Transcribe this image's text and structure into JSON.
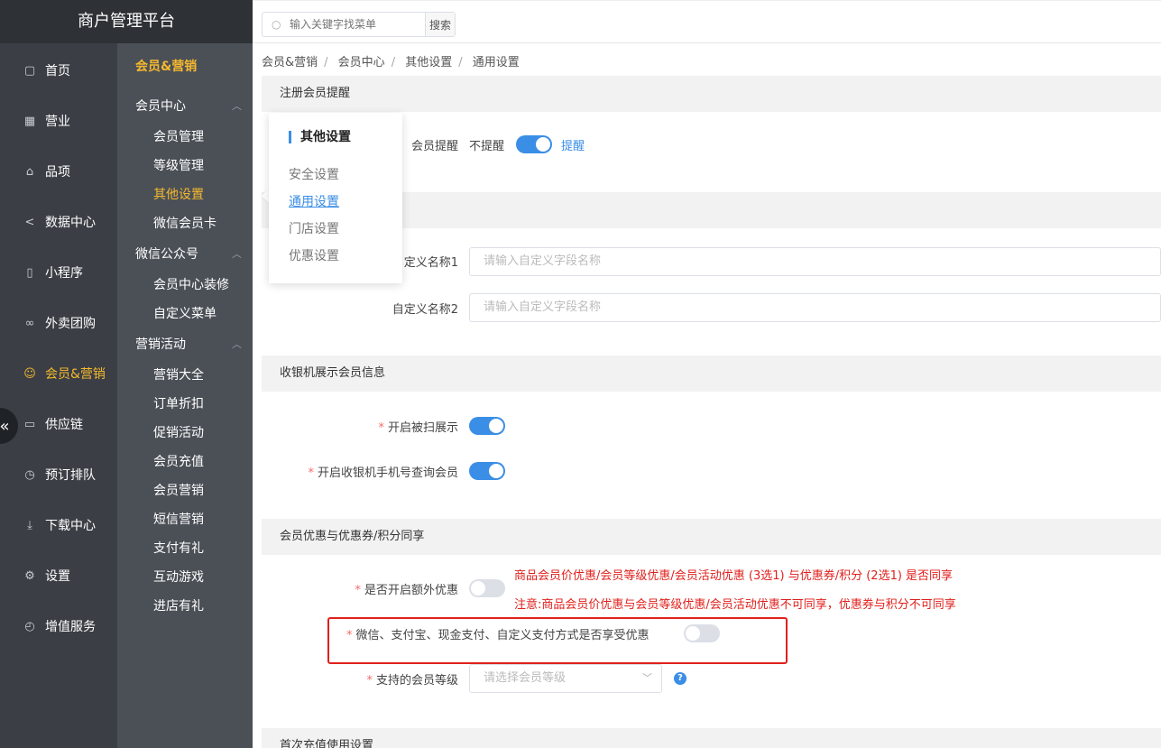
{
  "brand": "商户管理平台",
  "nav1": [
    {
      "label": "首页",
      "icon": "home-icon",
      "glyph": "▢",
      "active": false
    },
    {
      "label": "营业",
      "icon": "calendar-icon",
      "glyph": "▦",
      "active": false
    },
    {
      "label": "品项",
      "icon": "bag-icon",
      "glyph": "⌂",
      "active": false
    },
    {
      "label": "数据中心",
      "icon": "share-icon",
      "glyph": "<",
      "active": false
    },
    {
      "label": "小程序",
      "icon": "phone-icon",
      "glyph": "▯",
      "active": false
    },
    {
      "label": "外卖团购",
      "icon": "bike-icon",
      "glyph": "∞",
      "active": false
    },
    {
      "label": "会员&营销",
      "icon": "user-icon",
      "glyph": "☺",
      "active": true
    },
    {
      "label": "供应链",
      "icon": "truck-icon",
      "glyph": "▭",
      "active": false
    },
    {
      "label": "预订排队",
      "icon": "clock-icon",
      "glyph": "◷",
      "active": false
    },
    {
      "label": "下载中心",
      "icon": "download-icon",
      "glyph": "⤓",
      "active": false
    },
    {
      "label": "设置",
      "icon": "gear-icon",
      "glyph": "⚙",
      "active": false
    },
    {
      "label": "增值服务",
      "icon": "alarm-icon",
      "glyph": "◴",
      "active": false
    }
  ],
  "collapse_glyph": "«",
  "nav2": {
    "title": "会员&营销",
    "groups": [
      {
        "label": "会员中心",
        "items": [
          {
            "label": "会员管理",
            "active": false
          },
          {
            "label": "等级管理",
            "active": false
          },
          {
            "label": "其他设置",
            "active": true
          },
          {
            "label": "微信会员卡",
            "active": false
          }
        ]
      },
      {
        "label": "微信公众号",
        "items": [
          {
            "label": "会员中心装修",
            "active": false
          },
          {
            "label": "自定义菜单",
            "active": false
          }
        ]
      },
      {
        "label": "营销活动",
        "items": [
          {
            "label": "营销大全",
            "active": false
          },
          {
            "label": "订单折扣",
            "active": false
          },
          {
            "label": "促销活动",
            "active": false
          },
          {
            "label": "会员充值",
            "active": false
          },
          {
            "label": "会员营销",
            "active": false
          },
          {
            "label": "短信营销",
            "active": false
          },
          {
            "label": "支付有礼",
            "active": false
          },
          {
            "label": "互动游戏",
            "active": false
          },
          {
            "label": "进店有礼",
            "active": false
          }
        ]
      }
    ]
  },
  "search": {
    "placeholder": "输入关键字找菜单",
    "button": "搜索"
  },
  "breadcrumb": [
    "会员&营销",
    "会员中心",
    "其他设置",
    "通用设置"
  ],
  "popup": {
    "title": "其他设置",
    "items": [
      {
        "label": "安全设置",
        "active": false
      },
      {
        "label": "通用设置",
        "active": true
      },
      {
        "label": "门店设置",
        "active": false
      },
      {
        "label": "优惠设置",
        "active": false
      }
    ]
  },
  "sections": {
    "register": {
      "title": "注册会员提醒",
      "label": "会员提醒",
      "off_text": "不提醒",
      "on_text": "提醒",
      "switch_on": true
    },
    "custom_fields": {
      "field1_label": "自定义名称1",
      "field1_placeholder": "请输入自定义字段名称",
      "field2_label": "自定义名称2",
      "field2_placeholder": "请输入自定义字段名称"
    },
    "cashier": {
      "title": "收银机展示会员信息",
      "row1_label": "开启被扫展示",
      "row1_on": true,
      "row2_label": "开启收银机手机号查询会员",
      "row2_on": true
    },
    "discount": {
      "title": "会员优惠与优惠券/积分同享",
      "row1_label": "是否开启额外优惠",
      "row1_on": false,
      "note1": "商品会员价优惠/会员等级优惠/会员活动优惠 (3选1) 与优惠券/积分 (2选1) 是否同享",
      "note2": "注意:商品会员价优惠与会员等级优惠/会员活动优惠不可同享，优惠券与积分不可同享",
      "row2_label": "微信、支付宝、现金支付、自定义支付方式是否享受优惠",
      "row2_on": false,
      "row3_label": "支持的会员等级",
      "row3_placeholder": "请选择会员等级",
      "help": "?"
    },
    "first_recharge": {
      "title": "首次充值使用设置"
    }
  },
  "required_mark": "*",
  "colors": {
    "accent": "#3a8ee6",
    "active_nav": "#f5b82e",
    "warning": "#e0201c"
  }
}
